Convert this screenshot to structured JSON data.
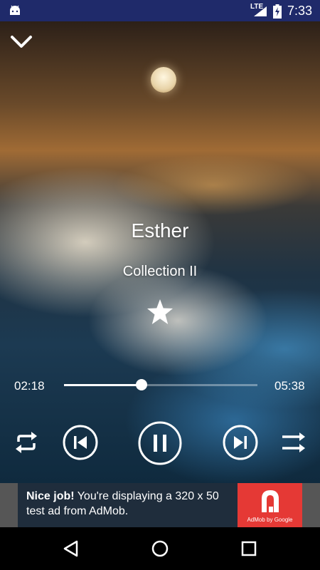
{
  "status_bar": {
    "network": "LTE",
    "time": "7:33"
  },
  "player": {
    "track_title": "Esther",
    "album": "Collection II",
    "elapsed": "02:18",
    "duration": "05:38",
    "progress": 0.4,
    "favorite": true,
    "state": "playing",
    "icons": {
      "collapse": "chevron-down-icon",
      "favorite": "star-icon",
      "repeat": "repeat-icon",
      "previous": "skip-previous-icon",
      "pause": "pause-icon",
      "next": "skip-next-icon",
      "shuffle": "shuffle-icon"
    }
  },
  "ad": {
    "headline": "Nice job!",
    "body": " You're displaying a 320 x 50 test ad from AdMob.",
    "logo_caption": "AdMob by Google",
    "logo_color": "#e53935"
  },
  "nav": {
    "icons": [
      "back-icon",
      "home-icon",
      "recents-icon"
    ]
  }
}
